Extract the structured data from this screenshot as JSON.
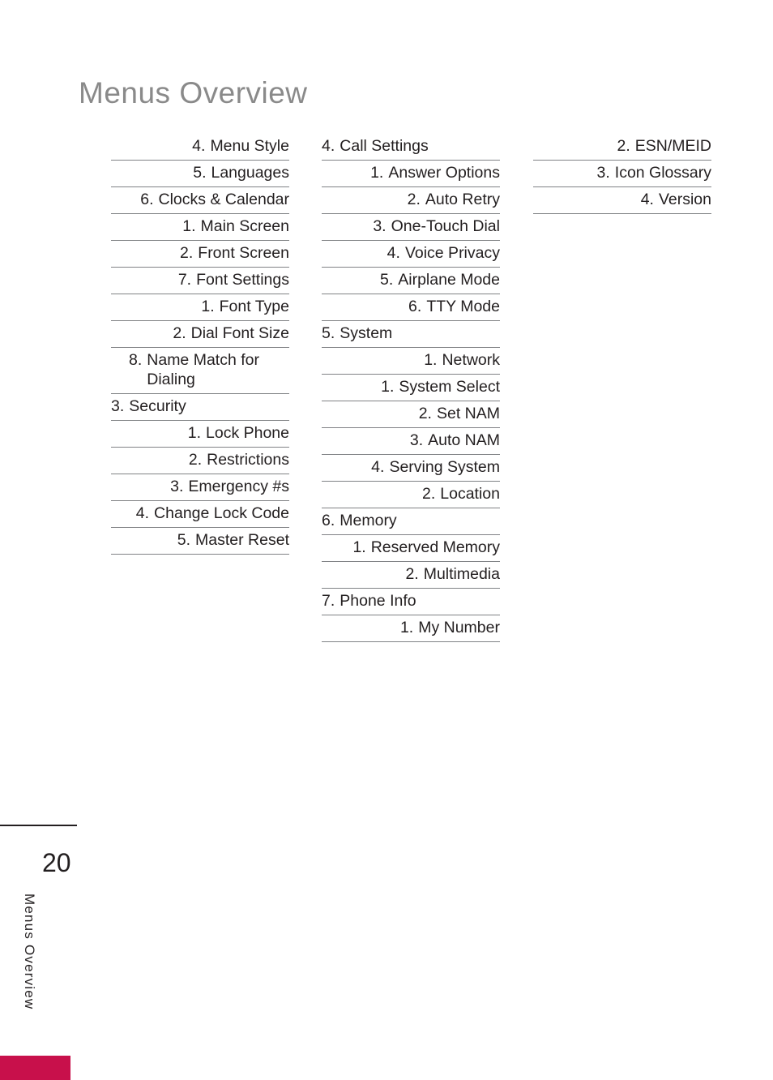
{
  "page": {
    "title": "Menus Overview",
    "side_tab_label": "Menus Overview",
    "side_tab_color": "#c8104b",
    "number": "20",
    "rule_color": "#808285",
    "title_color": "#8a8a8a",
    "text_color": "#231f20"
  },
  "columns": [
    {
      "name": "column-1",
      "entries": [
        {
          "num": "4.",
          "text": "Menu Style",
          "level": 1,
          "lines": 1
        },
        {
          "num": "5.",
          "text": "Languages",
          "level": 1,
          "lines": 1
        },
        {
          "num": "6.",
          "text": "Clocks & Calendar",
          "level": 1,
          "lines": 2
        },
        {
          "num": "1.",
          "text": "Main Screen",
          "level": 2,
          "lines": 1
        },
        {
          "num": "2.",
          "text": "Front Screen",
          "level": 2,
          "lines": 1
        },
        {
          "num": "7.",
          "text": "Font Settings",
          "level": 1,
          "lines": 1
        },
        {
          "num": "1.",
          "text": "Font Type",
          "level": 2,
          "lines": 1
        },
        {
          "num": "2.",
          "text": "Dial Font Size",
          "level": 2,
          "lines": 1
        },
        {
          "num": "8.",
          "text": "Name Match for Dialing",
          "level": 1,
          "lines": 2
        },
        {
          "num": "3.",
          "text": "Security",
          "level": 0,
          "lines": 1
        },
        {
          "num": "1.",
          "text": "Lock Phone",
          "level": 1,
          "lines": 1
        },
        {
          "num": "2.",
          "text": "Restrictions",
          "level": 1,
          "lines": 1
        },
        {
          "num": "3.",
          "text": "Emergency #s",
          "level": 1,
          "lines": 1
        },
        {
          "num": "4.",
          "text": "Change Lock Code",
          "level": 1,
          "lines": 2
        },
        {
          "num": "5.",
          "text": "Master Reset",
          "level": 1,
          "lines": 1
        }
      ]
    },
    {
      "name": "column-2",
      "entries": [
        {
          "num": "4.",
          "text": "Call Settings",
          "level": 0,
          "lines": 1
        },
        {
          "num": "1.",
          "text": "Answer Options",
          "level": 1,
          "lines": 1
        },
        {
          "num": "2.",
          "text": "Auto Retry",
          "level": 1,
          "lines": 1
        },
        {
          "num": "3.",
          "text": "One-Touch Dial",
          "level": 1,
          "lines": 1
        },
        {
          "num": "4.",
          "text": "Voice Privacy",
          "level": 1,
          "lines": 1
        },
        {
          "num": "5.",
          "text": "Airplane Mode",
          "level": 1,
          "lines": 1
        },
        {
          "num": "6.",
          "text": "TTY Mode",
          "level": 1,
          "lines": 1
        },
        {
          "num": "5.",
          "text": "System",
          "level": 0,
          "lines": 1
        },
        {
          "num": "1.",
          "text": "Network",
          "level": 1,
          "lines": 1
        },
        {
          "num": "1.",
          "text": "System Select",
          "level": 2,
          "lines": 2
        },
        {
          "num": "2.",
          "text": "Set NAM",
          "level": 2,
          "lines": 1
        },
        {
          "num": "3.",
          "text": "Auto NAM",
          "level": 2,
          "lines": 1
        },
        {
          "num": "4.",
          "text": "Serving System",
          "level": 2,
          "lines": 2
        },
        {
          "num": "2.",
          "text": "Location",
          "level": 1,
          "lines": 1
        },
        {
          "num": "6.",
          "text": "Memory",
          "level": 0,
          "lines": 1
        },
        {
          "num": "1.",
          "text": "Reserved Memory",
          "level": 1,
          "lines": 2
        },
        {
          "num": "2.",
          "text": "Multimedia",
          "level": 1,
          "lines": 1
        },
        {
          "num": "7.",
          "text": "Phone Info",
          "level": 0,
          "lines": 1
        },
        {
          "num": "1.",
          "text": "My Number",
          "level": 1,
          "lines": 1
        }
      ]
    },
    {
      "name": "column-3",
      "entries": [
        {
          "num": "2.",
          "text": "ESN/MEID",
          "level": 1,
          "lines": 1
        },
        {
          "num": "3.",
          "text": "Icon Glossary",
          "level": 1,
          "lines": 1
        },
        {
          "num": "4.",
          "text": "Version",
          "level": 1,
          "lines": 1
        }
      ]
    }
  ]
}
